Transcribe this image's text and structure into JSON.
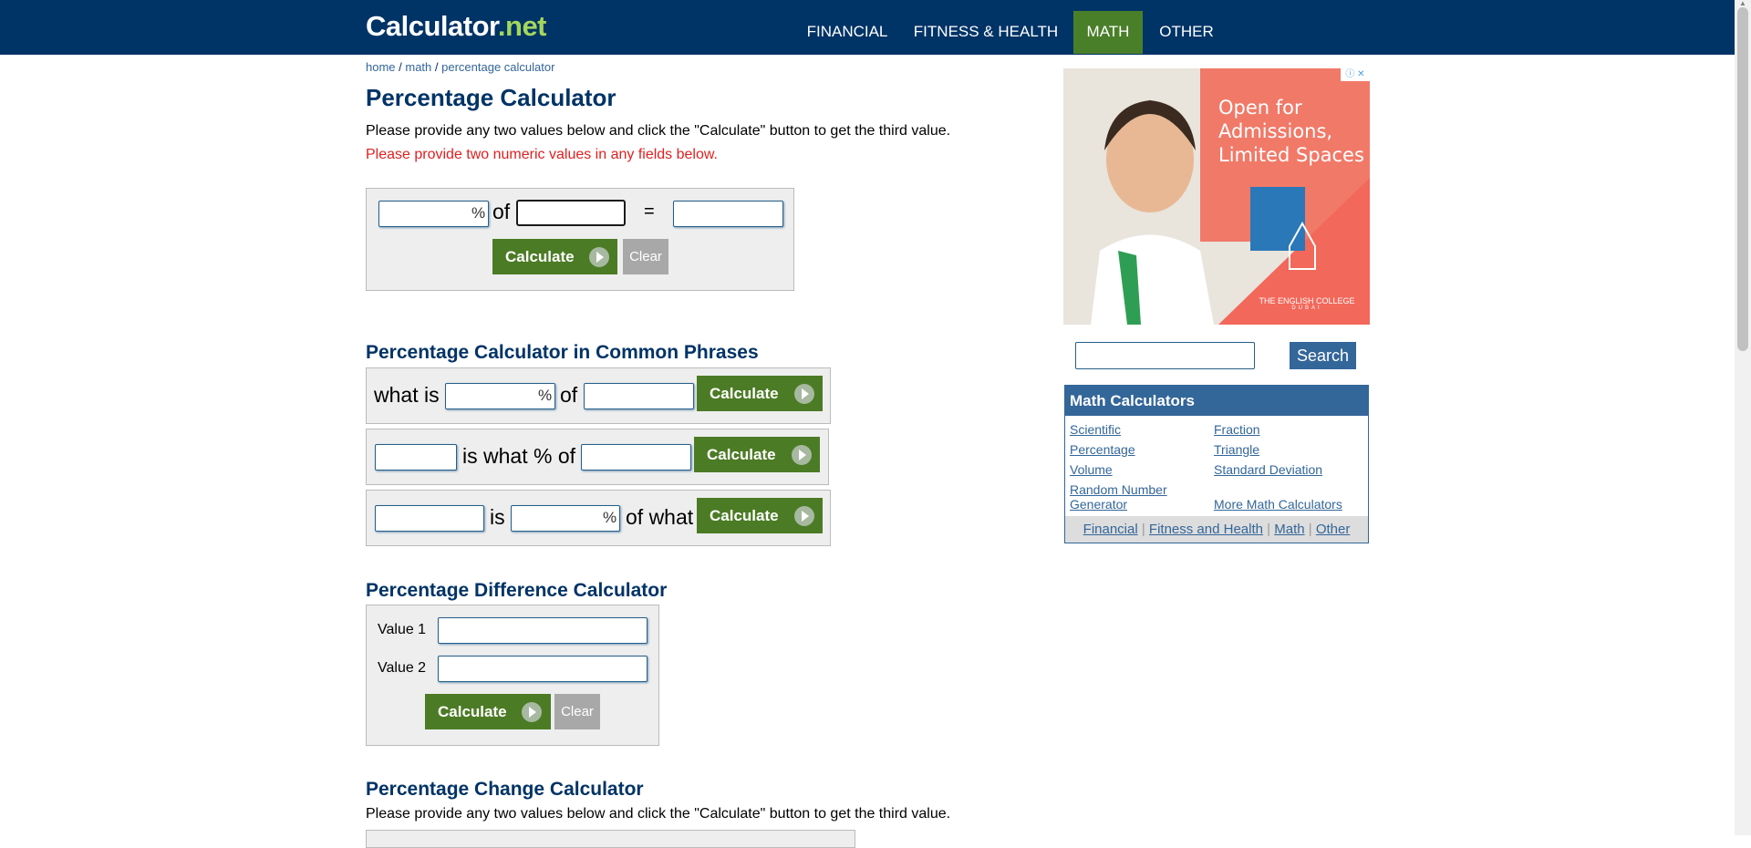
{
  "header": {
    "logo_main": "Calculator",
    "logo_tld": ".net",
    "nav": [
      {
        "label": "FINANCIAL"
      },
      {
        "label": "FITNESS & HEALTH"
      },
      {
        "label": "MATH"
      },
      {
        "label": "OTHER"
      }
    ]
  },
  "breadcrumb": {
    "home": "home",
    "sep": " / ",
    "math": "math",
    "current": "percentage calculator"
  },
  "page_title": "Percentage Calculator",
  "intro": "Please provide any two values below and click the \"Calculate\" button to get the third value.",
  "error": "Please provide two numeric values in any fields below.",
  "main_calc": {
    "percent_sign": "%",
    "of": "of",
    "equals": "=",
    "calculate": "Calculate",
    "clear": "Clear"
  },
  "phrases": {
    "heading": "Percentage Calculator in Common Phrases",
    "row1": {
      "what_is": "what is",
      "percent_sign": "%",
      "of": "of",
      "calculate": "Calculate"
    },
    "row2": {
      "is_what_pct_of": "is what % of",
      "calculate": "Calculate"
    },
    "row3": {
      "is": "is",
      "percent_sign": "%",
      "of_what": "of what",
      "calculate": "Calculate"
    }
  },
  "difference": {
    "heading": "Percentage Difference Calculator",
    "value1": "Value 1",
    "value2": "Value 2",
    "calculate": "Calculate",
    "clear": "Clear"
  },
  "change": {
    "heading": "Percentage Change Calculator",
    "intro": "Please provide any two values below and click the \"Calculate\" button to get the third value."
  },
  "ad": {
    "headline": "Open for Admissions, Limited Spaces",
    "college": "THE ENGLISH COLLEGE",
    "city": "DUBAI"
  },
  "search": {
    "button": "Search"
  },
  "math_calculators": {
    "title": "Math Calculators",
    "links": {
      "scientific": "Scientific",
      "fraction": "Fraction",
      "percentage": "Percentage",
      "triangle": "Triangle",
      "volume": "Volume",
      "std": "Standard Deviation",
      "rng1": "Random Number",
      "rng2": "Generator",
      "more": "More Math Calculators"
    },
    "footer": {
      "financial": "Financial",
      "fitness": "Fitness and Health",
      "math": "Math",
      "other": "Other",
      "sep": " | "
    }
  },
  "colors": {
    "header_bg": "#003366",
    "active_nav": "#4a7f2a",
    "calc_button": "#4c7b25",
    "title": "#003366",
    "error": "#e02020"
  }
}
